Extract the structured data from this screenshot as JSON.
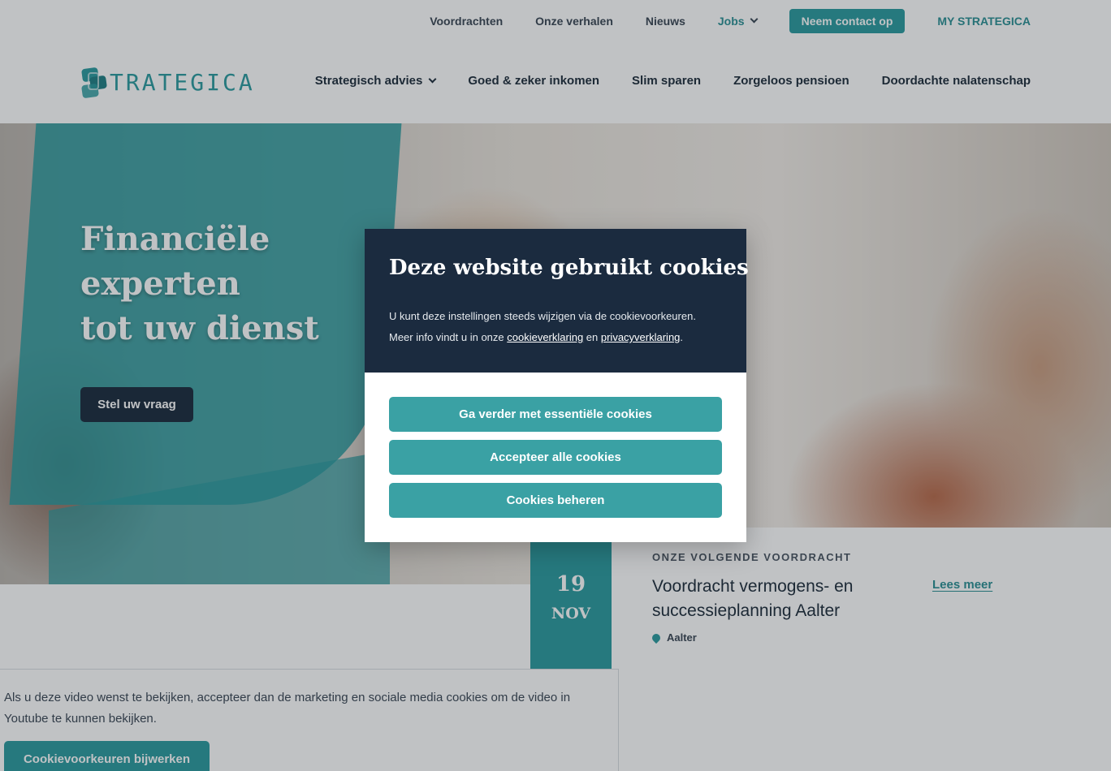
{
  "topnav": {
    "items": [
      "Voordrachten",
      "Onze verhalen",
      "Nieuws"
    ],
    "jobs": "Jobs",
    "contact": "Neem contact op",
    "my": "MY STRATEGICA"
  },
  "logo": {
    "text": "TRATEGICA"
  },
  "mainnav": {
    "items": [
      "Strategisch advies",
      "Goed & zeker inkomen",
      "Slim sparen",
      "Zorgeloos pensioen",
      "Doordachte nalatenschap"
    ]
  },
  "hero": {
    "title_lines": [
      "Financiële",
      "experten",
      "tot uw dienst"
    ],
    "button": "Stel uw vraag"
  },
  "event": {
    "day": "19",
    "month": "NOV",
    "kicker": "ONZE VOLGENDE VOORDRACHT",
    "title": "Voordracht vermogens- en successieplanning Aalter",
    "location": "Aalter",
    "more": "Lees meer"
  },
  "video": {
    "text": "Als u deze video wenst te bekijken, accepteer dan de marketing en sociale media cookies om de video in Youtube te kunnen bekijken.",
    "button": "Cookievoorkeuren bijwerken"
  },
  "cookie": {
    "title": "Deze website gebruikt cookies",
    "line1": "U kunt deze instellingen steeds wijzigen via de cookievoorkeuren.",
    "line2_prefix": "Meer info vindt u in onze ",
    "link1": "cookieverklaring",
    "connector": " en ",
    "link2": "privacyverklaring",
    "suffix": ".",
    "buttons": [
      "Ga verder met essentiële cookies",
      "Accepteer alle cookies",
      "Cookies beheren"
    ]
  },
  "colors": {
    "teal": "#2a9a9e",
    "navy": "#1b2b3f"
  }
}
